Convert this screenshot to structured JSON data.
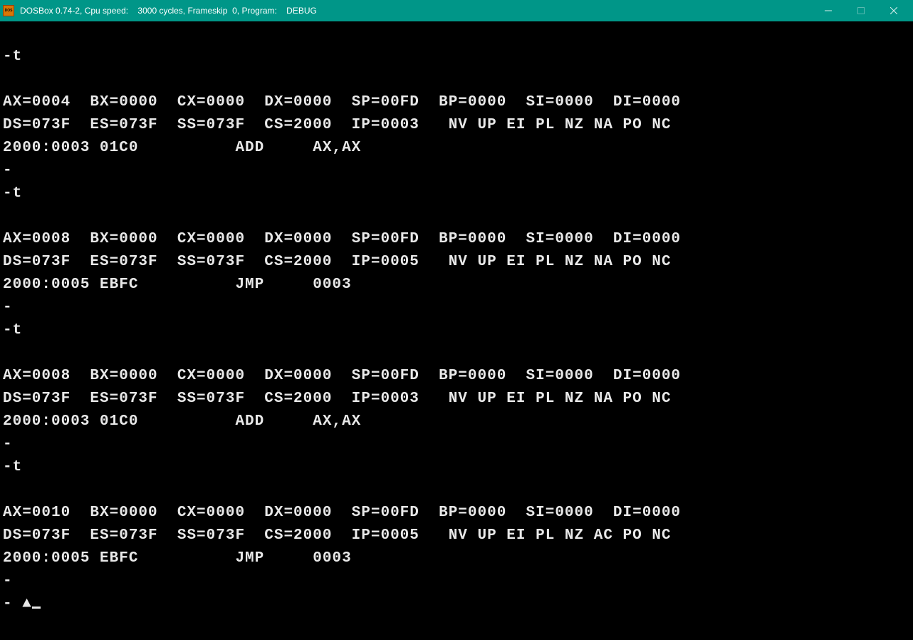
{
  "window": {
    "title": "DOSBox 0.74-2, Cpu speed:    3000 cycles, Frameskip  0, Program:    DEBUG"
  },
  "traces": [
    {
      "prompt": "-t",
      "regs1": "AX=0004  BX=0000  CX=0000  DX=0000  SP=00FD  BP=0000  SI=0000  DI=0000",
      "regs2": "DS=073F  ES=073F  SS=073F  CS=2000  IP=0003   NV UP EI PL NZ NA PO NC",
      "disasm": "2000:0003 01C0          ADD     AX,AX"
    },
    {
      "prompt": "-t",
      "regs1": "AX=0008  BX=0000  CX=0000  DX=0000  SP=00FD  BP=0000  SI=0000  DI=0000",
      "regs2": "DS=073F  ES=073F  SS=073F  CS=2000  IP=0005   NV UP EI PL NZ NA PO NC",
      "disasm": "2000:0005 EBFC          JMP     0003"
    },
    {
      "prompt": "-t",
      "regs1": "AX=0008  BX=0000  CX=0000  DX=0000  SP=00FD  BP=0000  SI=0000  DI=0000",
      "regs2": "DS=073F  ES=073F  SS=073F  CS=2000  IP=0003   NV UP EI PL NZ NA PO NC",
      "disasm": "2000:0003 01C0          ADD     AX,AX"
    },
    {
      "prompt": "-t",
      "regs1": "AX=0010  BX=0000  CX=0000  DX=0000  SP=00FD  BP=0000  SI=0000  DI=0000",
      "regs2": "DS=073F  ES=073F  SS=073F  CS=2000  IP=0005   NV UP EI PL NZ AC PO NC",
      "disasm": "2000:0005 EBFC          JMP     0003"
    }
  ],
  "final_prompt": "- ▲"
}
